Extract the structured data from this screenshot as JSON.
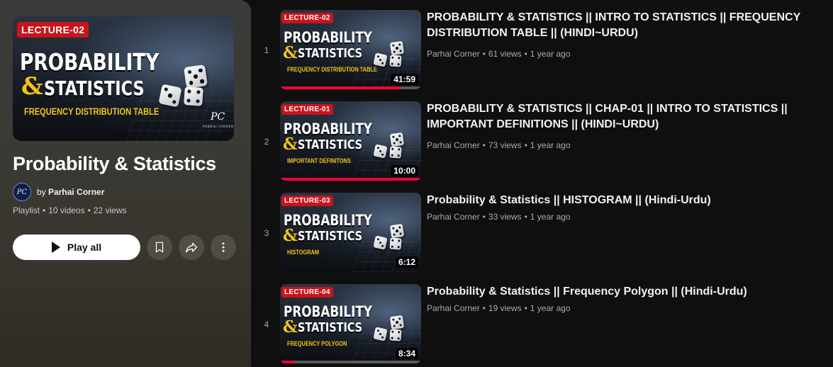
{
  "playlist": {
    "title": "Probability & Statistics",
    "by_prefix": "by",
    "owner": "Parhai Corner",
    "avatar_text": "PC",
    "type": "Playlist",
    "video_count": "10 videos",
    "views": "22 views",
    "separator": "•",
    "play_all_label": "Play all",
    "hero": {
      "badge": "LECTURE-02",
      "line1": "PROBABILITY",
      "amp": "&",
      "line2": "STATISTICS",
      "sub": "FREQUENCY DISTRIBUTION TABLE",
      "logo": "PC",
      "logo_caption": "PARHAI CORNER"
    }
  },
  "videos": [
    {
      "index": "1",
      "title": "PROBABILITY & STATISTICS || INTRO TO STATISTICS || FREQUENCY DISTRIBUTION TABLE || (HINDI~URDU)",
      "channel": "Parhai Corner",
      "views": "61 views",
      "age": "1 year ago",
      "duration": "41:59",
      "watched": 0.85,
      "thumb": {
        "badge": "LECTURE-02",
        "line1": "PROBABILITY",
        "amp": "&",
        "line2": "STATISTICS",
        "sub": "FREQUENCY DISTRIBUTION TABLE"
      }
    },
    {
      "index": "2",
      "title": "PROBABILITY & STATISTICS || CHAP-01 || INTRO TO STATISTICS || IMPORTANT DEFINITIONS || (HINDI~URDU)",
      "channel": "Parhai Corner",
      "views": "73 views",
      "age": "1 year ago",
      "duration": "10:00",
      "watched": 1.0,
      "thumb": {
        "badge": "LECTURE-01",
        "line1": "PROBABILITY",
        "amp": "&",
        "line2": "STATISTICS",
        "sub": "IMPORTANT DEFINITONS"
      }
    },
    {
      "index": "3",
      "title": "Probability & Statistics || HISTOGRAM || (Hindi-Urdu)",
      "channel": "Parhai Corner",
      "views": "33 views",
      "age": "1 year ago",
      "duration": "6:12",
      "watched": 0,
      "thumb": {
        "badge": "LECTURE-03",
        "line1": "PROBABILITY",
        "amp": "&",
        "line2": "STATISTICS",
        "sub": "HISTOGRAM"
      }
    },
    {
      "index": "4",
      "title": "Probability & Statistics || Frequency Polygon || (Hindi-Urdu)",
      "channel": "Parhai Corner",
      "views": "19 views",
      "age": "1 year ago",
      "duration": "8:34",
      "watched": 0.1,
      "thumb": {
        "badge": "LECTURE-04",
        "line1": "PROBABILITY",
        "amp": "&",
        "line2": "STATISTICS",
        "sub": "FREQUENCY POLYGON"
      }
    }
  ],
  "colors": {
    "accent_red": "#ff0033",
    "badge_red": "#c8141b",
    "title_yellow": "#f2c316"
  }
}
